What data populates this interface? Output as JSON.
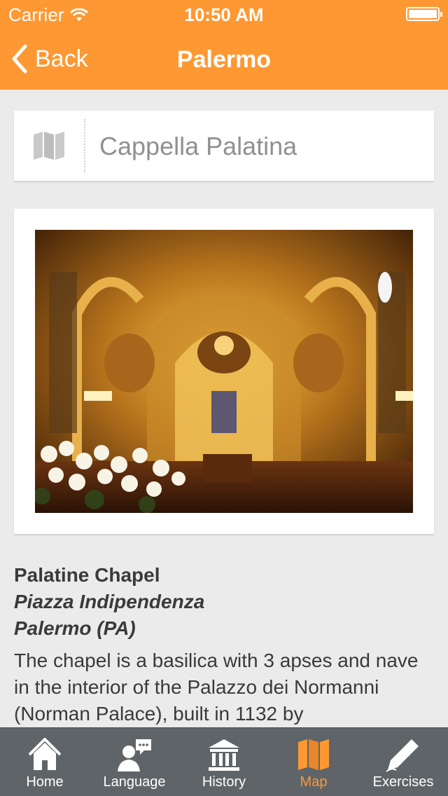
{
  "status_bar": {
    "carrier": "Carrier",
    "time": "10:50 AM"
  },
  "nav": {
    "back_label": "Back",
    "title": "Palermo"
  },
  "place": {
    "name": "Cappella Palatina",
    "icon": "map-icon"
  },
  "photo": {
    "alt": "Interior of the Cappella Palatina with golden mosaics"
  },
  "details": {
    "name": "Palatine Chapel",
    "address_line1": "Piazza Indipendenza",
    "address_line2": "Palermo (PA)",
    "description": "The chapel is a basilica with 3 apses and nave in the interior of the Palazzo dei Normanni (Norman Palace), built in 1132 by"
  },
  "tabs": [
    {
      "label": "Home",
      "icon": "home-icon"
    },
    {
      "label": "Language",
      "icon": "language-icon"
    },
    {
      "label": "History",
      "icon": "history-icon"
    },
    {
      "label": "Map",
      "icon": "map-icon"
    },
    {
      "label": "Exercises",
      "icon": "pencil-icon"
    }
  ],
  "colors": {
    "accent": "#fe9832",
    "tabbar": "#5f6468",
    "background": "#ebebeb"
  }
}
